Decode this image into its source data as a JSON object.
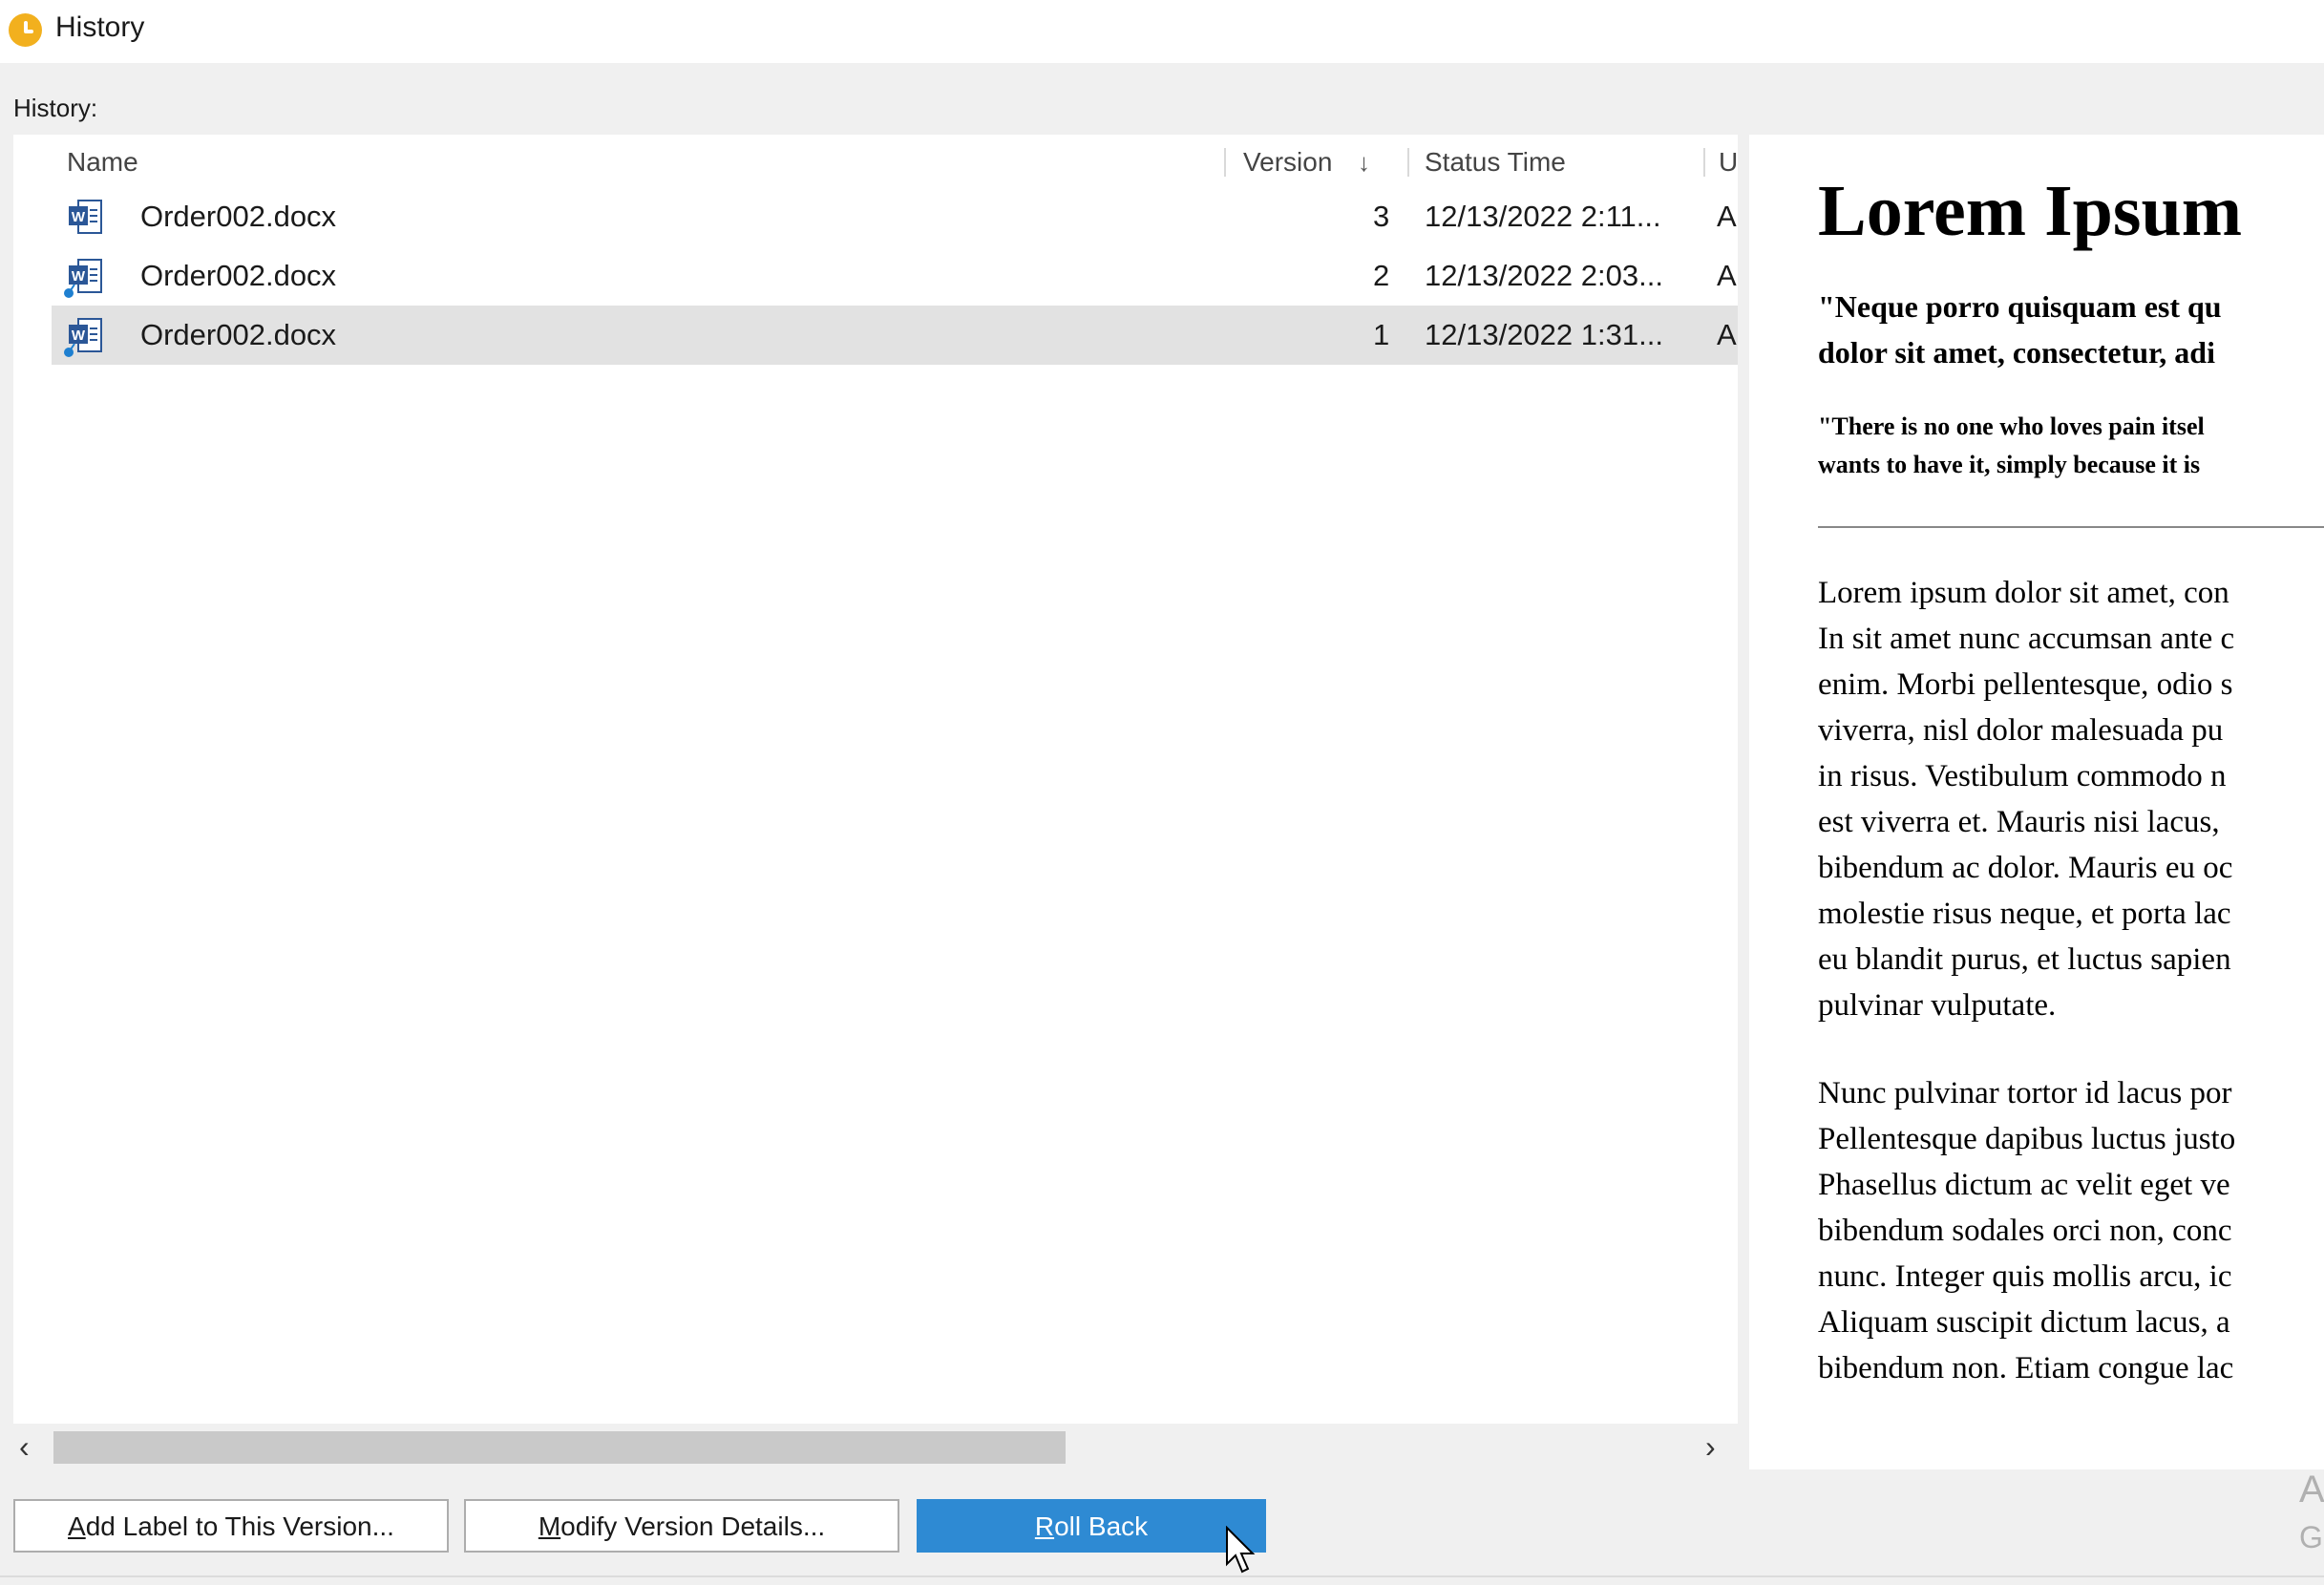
{
  "window": {
    "title": "History",
    "icon": "history-clock-icon",
    "accent": "#f2b01e"
  },
  "history_label": "History:",
  "columns": {
    "name": "Name",
    "version": "Version",
    "status_time": "Status Time",
    "user": "U"
  },
  "rows": [
    {
      "name": "Order002.docx",
      "version": "3",
      "status_time": "12/13/2022 2:11...",
      "user": "A",
      "icon": "word-doc-icon",
      "selected": false
    },
    {
      "name": "Order002.docx",
      "version": "2",
      "status_time": "12/13/2022 2:03...",
      "user": "A",
      "icon": "word-doc-version-icon",
      "selected": false
    },
    {
      "name": "Order002.docx",
      "version": "1",
      "status_time": "12/13/2022 1:31...",
      "user": "A",
      "icon": "word-doc-version-icon",
      "selected": true
    }
  ],
  "preview": {
    "heading": "Lorem Ipsum",
    "quote_line1": "\"Neque porro quisquam est qu",
    "quote_line2": "dolor sit amet, consectetur, adi",
    "quote2_line1": "\"There is no one who loves pain itsel",
    "quote2_line2": "wants to have it, simply because it is",
    "para1": [
      "Lorem ipsum dolor sit amet, con",
      "In sit amet nunc accumsan ante c",
      "enim. Morbi pellentesque, odio s",
      "viverra, nisl dolor malesuada pu",
      "in risus. Vestibulum commodo n",
      "est viverra et. Mauris nisi lacus,",
      "bibendum ac dolor. Mauris eu oc",
      "molestie risus neque, et porta lac",
      "eu blandit purus, et luctus sapien",
      "pulvinar vulputate."
    ],
    "para2": [
      "Nunc pulvinar tortor id lacus por",
      "Pellentesque dapibus luctus justo",
      "Phasellus dictum ac velit eget ve",
      "bibendum sodales orci non, conc",
      "nunc. Integer quis mollis arcu, ic",
      "Aliquam suscipit dictum lacus, a",
      "bibendum non. Etiam congue lac"
    ],
    "ghost1": "A",
    "ghost2": "G"
  },
  "buttons": {
    "add_label": {
      "mnemonic": "A",
      "rest": "dd Label to This Version..."
    },
    "modify": {
      "mnemonic": "M",
      "rest": "odify Version Details..."
    },
    "rollback": {
      "mnemonic": "R",
      "rest": "oll Back"
    }
  },
  "colors": {
    "primary_button": "#2e8ad3",
    "selection": "#e2e2e2",
    "word_blue": "#2b5797"
  }
}
